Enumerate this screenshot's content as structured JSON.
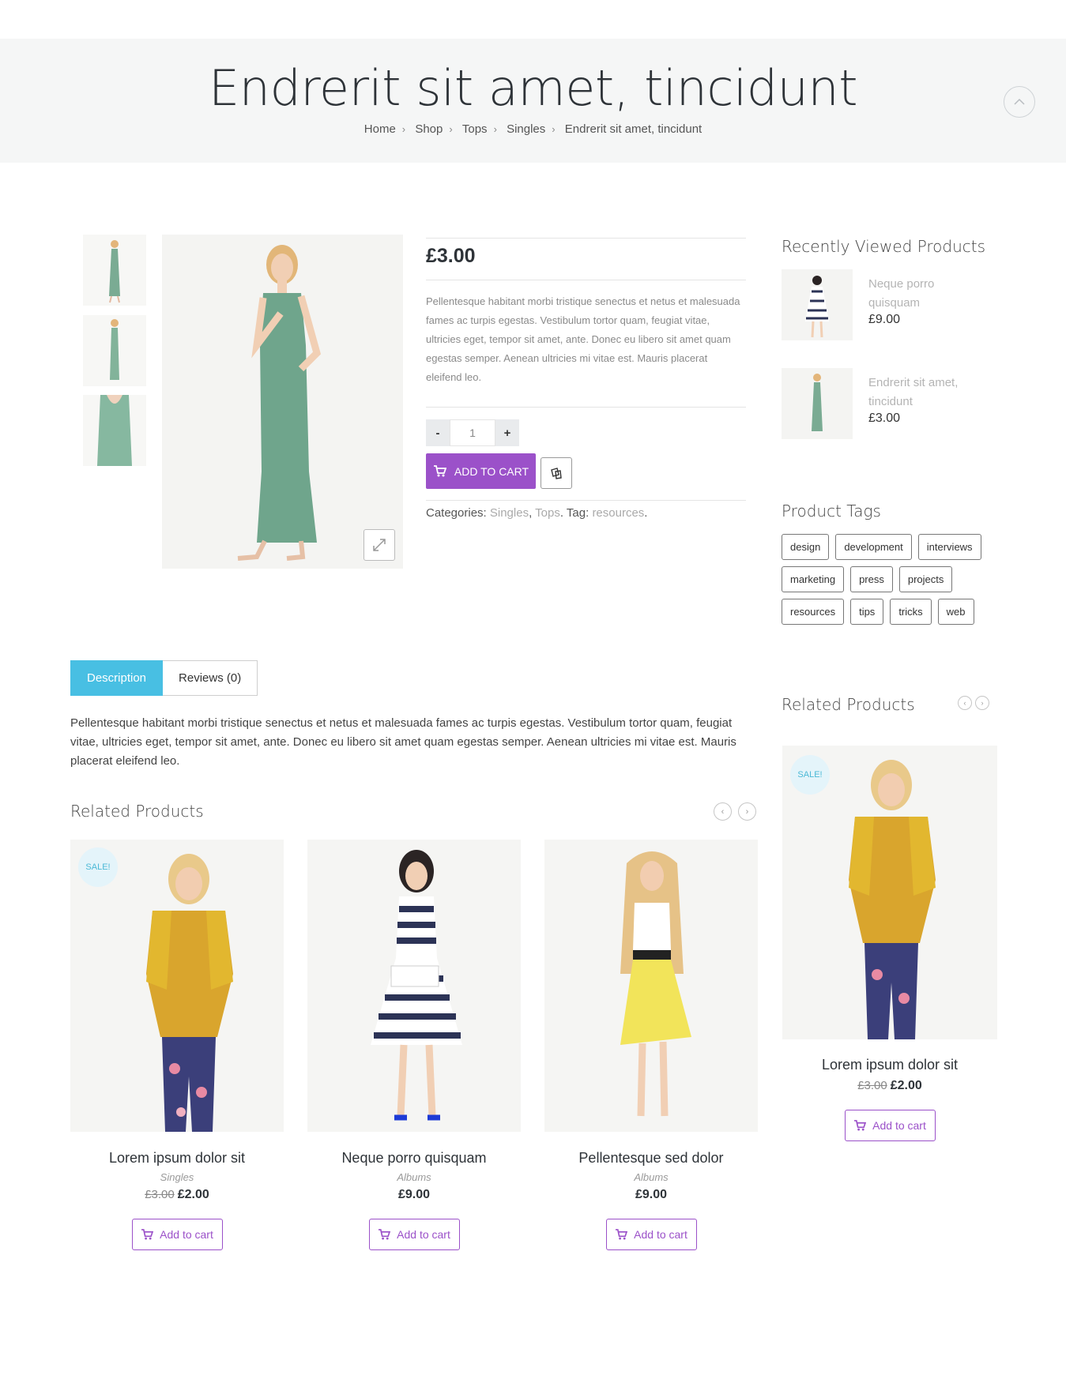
{
  "header": {
    "title": "Endrerit sit amet, tincidunt",
    "breadcrumb": [
      "Home",
      "Shop",
      "Tops",
      "Singles",
      "Endrerit sit amet, tincidunt"
    ],
    "breadcrumb_separator_icon": "chevron-right-icon",
    "scroll_up_icon": "chevron-up-circle-icon"
  },
  "product": {
    "price": "£3.00",
    "short_description": "Pellentesque habitant morbi tristique senectus et netus et malesuada fames ac turpis egestas. Vestibulum tortor quam, feugiat vitae, ultricies eget, tempor sit amet, ante. Donec eu libero sit amet quam egestas semper. Aenean ultricies mi vitae est. Mauris placerat eleifend leo.",
    "qty_minus": "-",
    "qty_value": "1",
    "qty_plus": "+",
    "add_to_cart": "ADD TO CART",
    "meta": {
      "categories_label": "Categories: ",
      "category_1": "Singles",
      "comma": ", ",
      "category_2": "Tops",
      "tag_label": ". Tag: ",
      "tag_1": "resources",
      "end": "."
    }
  },
  "tabs": {
    "description": "Description",
    "reviews": "Reviews (0)",
    "description_text": "Pellentesque habitant morbi tristique senectus et netus et malesuada fames ac turpis egestas. Vestibulum tortor quam, feugiat vitae, ultricies eget, tempor sit amet, ante. Donec eu libero sit amet quam egestas semper. Aenean ultricies mi vitae est. Mauris placerat eleifend leo."
  },
  "related": {
    "title": "Related Products",
    "items": [
      {
        "name": "Lorem ipsum dolor sit",
        "category": "Singles",
        "old_price": "£3.00",
        "price": "£2.00",
        "sale": "SALE!",
        "button": "Add to cart"
      },
      {
        "name": "Neque porro quisquam",
        "category": "Albums",
        "old_price": "",
        "price": "£9.00",
        "button": "Add to cart"
      },
      {
        "name": "Pellentesque sed dolor",
        "category": "Albums",
        "old_price": "",
        "price": "£9.00",
        "button": "Add to cart"
      }
    ]
  },
  "sidebar": {
    "recently_viewed_title": "Recently Viewed Products",
    "recently_viewed": [
      {
        "name": "Neque porro quisquam",
        "price": "£9.00"
      },
      {
        "name": "Endrerit sit amet, tincidunt",
        "price": "£3.00"
      }
    ],
    "tags_title": "Product Tags",
    "tags": [
      "design",
      "development",
      "interviews",
      "marketing",
      "press",
      "projects",
      "resources",
      "tips",
      "tricks",
      "web"
    ],
    "related_title": "Related Products",
    "related_item": {
      "name": "Lorem ipsum dolor sit",
      "old_price": "£3.00",
      "price": "£2.00",
      "sale": "SALE!",
      "button": "Add to cart"
    }
  },
  "colors": {
    "accent_purple": "#9b51c9",
    "tab_blue": "#48bfe3",
    "hero_bg": "#f5f6f6"
  }
}
